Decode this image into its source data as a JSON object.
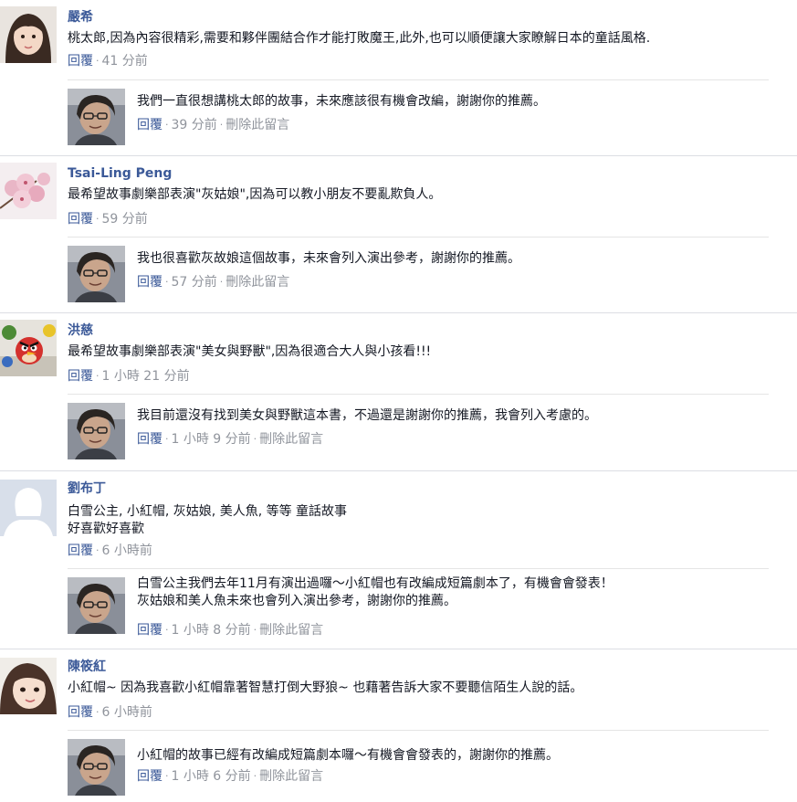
{
  "comments": [
    {
      "author": "嚴希",
      "text": "桃太郎,因為內容很精彩,需要和夥伴團結合作才能打敗魔王,此外,也可以順便讓大家瞭解日本的童話風格.",
      "reply_label": "回覆",
      "time": "41 分前",
      "avatar_icon": "user-photo-girl",
      "reply": {
        "text": "我們一直很想講桃太郎的故事，未來應該很有機會改編，謝謝你的推薦。",
        "reply_label": "回覆",
        "time": "39 分前",
        "delete_label": "刪除此留言",
        "avatar_icon": "page-admin-photo"
      }
    },
    {
      "author": "Tsai-Ling Peng",
      "text": "最希望故事劇樂部表演\"灰姑娘\",因為可以教小朋友不要亂欺負人。",
      "reply_label": "回覆",
      "time": "59 分前",
      "avatar_icon": "flower-photo",
      "reply": {
        "text": "我也很喜歡灰故娘這個故事，未來會列入演出參考，謝謝你的推薦。",
        "reply_label": "回覆",
        "time": "57 分前",
        "delete_label": "刪除此留言",
        "avatar_icon": "page-admin-photo"
      }
    },
    {
      "author": "洪慈",
      "text": "最希望故事劇樂部表演\"美女與野獸\",因為很適合大人與小孩看!!!",
      "reply_label": "回覆",
      "time": "1 小時 21 分前",
      "avatar_icon": "angry-birds-photo",
      "reply": {
        "text": "我目前還沒有找到美女與野獸這本書，不過還是謝謝你的推薦，我會列入考慮的。",
        "reply_label": "回覆",
        "time": "1 小時 9 分前",
        "delete_label": "刪除此留言",
        "avatar_icon": "page-admin-photo"
      }
    },
    {
      "author": "劉布丁",
      "text": "白雪公主, 小紅帽, 灰姑娘, 美人魚, 等等 童話故事\n好喜歡好喜歡",
      "reply_label": "回覆",
      "time": "6 小時前",
      "avatar_icon": "default-female-silhouette",
      "reply": {
        "text": "白雪公主我們去年11月有演出過囉～小紅帽也有改編成短篇劇本了，有機會會發表！\n灰姑娘和美人魚未來也會列入演出參考，謝謝你的推薦。",
        "reply_label": "回覆",
        "time": "1 小時 8 分前",
        "delete_label": "刪除此留言",
        "avatar_icon": "page-admin-photo"
      }
    },
    {
      "author": "陳筱紅",
      "text": "小紅帽~ 因為我喜歡小紅帽靠著智慧打倒大野狼~ 也藉著告訴大家不要聽信陌生人說的話。",
      "reply_label": "回覆",
      "time": "6 小時前",
      "avatar_icon": "user-photo-girl-2",
      "reply": {
        "text": "小紅帽的故事已經有改編成短篇劇本囉～有機會會發表的，謝謝你的推薦。",
        "reply_label": "回覆",
        "time": "1 小時 6 分前",
        "delete_label": "刪除此留言",
        "avatar_icon": "page-admin-photo"
      }
    }
  ],
  "colors": {
    "name_link": "#3b5998",
    "meta_gray": "#90949c",
    "separator": "#dcdee3"
  }
}
